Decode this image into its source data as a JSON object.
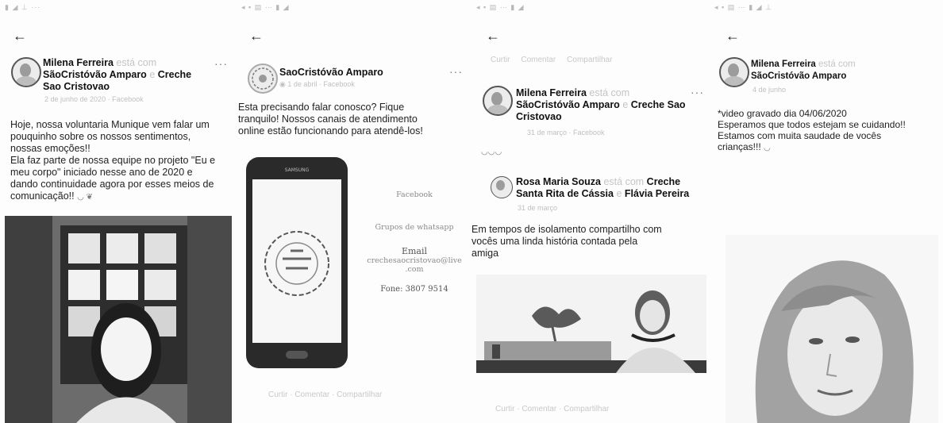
{
  "panel1": {
    "author_name": "Milena Ferreira",
    "author_action": "está com",
    "tagged_page": "SãoCristóvão Amparo",
    "connector": "e",
    "tagged_page2": "Creche Sao Cristovao",
    "meta": "2 de junho de 2020 · Facebook",
    "text_lines": [
      "Hoje, nossa voluntaria Munique vem falar um",
      "pouquinho sobre os nossos sentimentos,",
      "nossas emoções!!",
      "Ela faz parte de nossa equipe no projeto \"Eu e",
      "meu corpo\" iniciado nesse ano de 2020 e",
      "dando continuidade agora por esses meios de",
      "comunicação!!"
    ]
  },
  "panel2": {
    "page_name": "SaoCristóvão Amparo",
    "meta": "1 de abril · Facebook",
    "text_lines": [
      "Esta precisando falar conosco? Fique",
      "tranquilo! Nossos canais de atendimento",
      "online estão funcionando para atendê-los!"
    ],
    "phone_brand": "SAMSUNG",
    "side_info": [
      "Facebook",
      "Grupos de whatsapp",
      "Email",
      "crechesaocristovao@live",
      ".com",
      "Fone: 3807 9514"
    ],
    "footer": "Curtir · Comentar · Compartilhar"
  },
  "panel3": {
    "header_links": [
      "Curtir",
      "Comentar",
      "Compartilhar"
    ],
    "author_name": "Milena Ferreira",
    "author_action": "está com",
    "tagged_page": "SãoCristóvão Amparo",
    "connector": "e",
    "tagged_page2": "Creche Sao Cristovao",
    "meta": "31 de março · Facebook",
    "shared_author": "Rosa Maria Souza",
    "shared_action": "está com",
    "shared_tag1": "Creche",
    "shared_tag2": "Santa Rita de Cássia",
    "shared_connector": "e",
    "shared_tag3": "Flávia Pereira",
    "shared_meta": "31 de março",
    "text_lines": [
      "Em tempos de isolamento compartilho com",
      "vocês uma linda história contada pela",
      "amiga"
    ],
    "footer": "Curtir · Comentar · Compartilhar"
  },
  "panel4": {
    "author_name": "Milena Ferreira",
    "author_action": "está com",
    "tagged_page": "SãoCristóvão Amparo",
    "meta": "4 de junho",
    "text_lines": [
      "*video gravado dia 04/06/2020",
      "Esperamos que todos estejam se cuidando!!",
      "Estamos com muita saudade de vocês",
      "crianças!!!"
    ]
  },
  "icons": [
    "back-arrow-icon",
    "more-options-icon",
    "globe-icon",
    "emoji-icon"
  ],
  "colors": {
    "background": "#ffffff",
    "text": "#1a1a1a",
    "faint": "#c4c4c4"
  }
}
